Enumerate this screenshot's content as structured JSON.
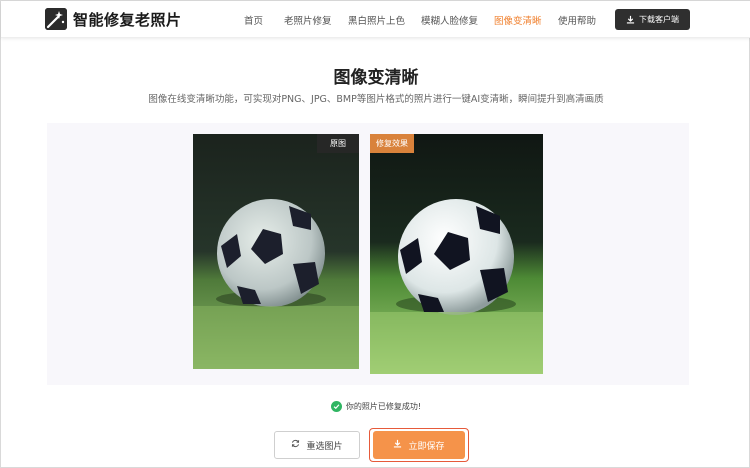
{
  "header": {
    "app_title": "智能修复老照片",
    "nav": [
      {
        "label": "首页",
        "active": false
      },
      {
        "label": "老照片修复",
        "active": false
      },
      {
        "label": "黑白照片上色",
        "active": false
      },
      {
        "label": "模糊人脸修复",
        "active": false
      },
      {
        "label": "图像变清晰",
        "active": true
      },
      {
        "label": "使用帮助",
        "active": false
      }
    ],
    "download_label": "下载客户端"
  },
  "main": {
    "title": "图像变清晰",
    "subtitle": "图像在线变清晰功能，可实现对PNG、JPG、BMP等图片格式的照片进行一键AI变清晰，瞬间提升到高清画质",
    "original_badge": "原图",
    "enhanced_badge": "修复效果",
    "status_text": "你的照片已修复成功!",
    "reselect_label": "重选图片",
    "save_label": "立即保存"
  },
  "icons": {
    "logo": "magic-wand-icon",
    "download": "download-icon",
    "status": "check-circle-icon",
    "reselect": "refresh-icon",
    "save": "download-icon"
  },
  "colors": {
    "accent": "#f07f2c",
    "save_button": "#f5934a",
    "save_outline": "#e65a3a",
    "download_button": "#2f2f2f",
    "success": "#2fb562",
    "enhanced_badge": "#d9823b"
  }
}
